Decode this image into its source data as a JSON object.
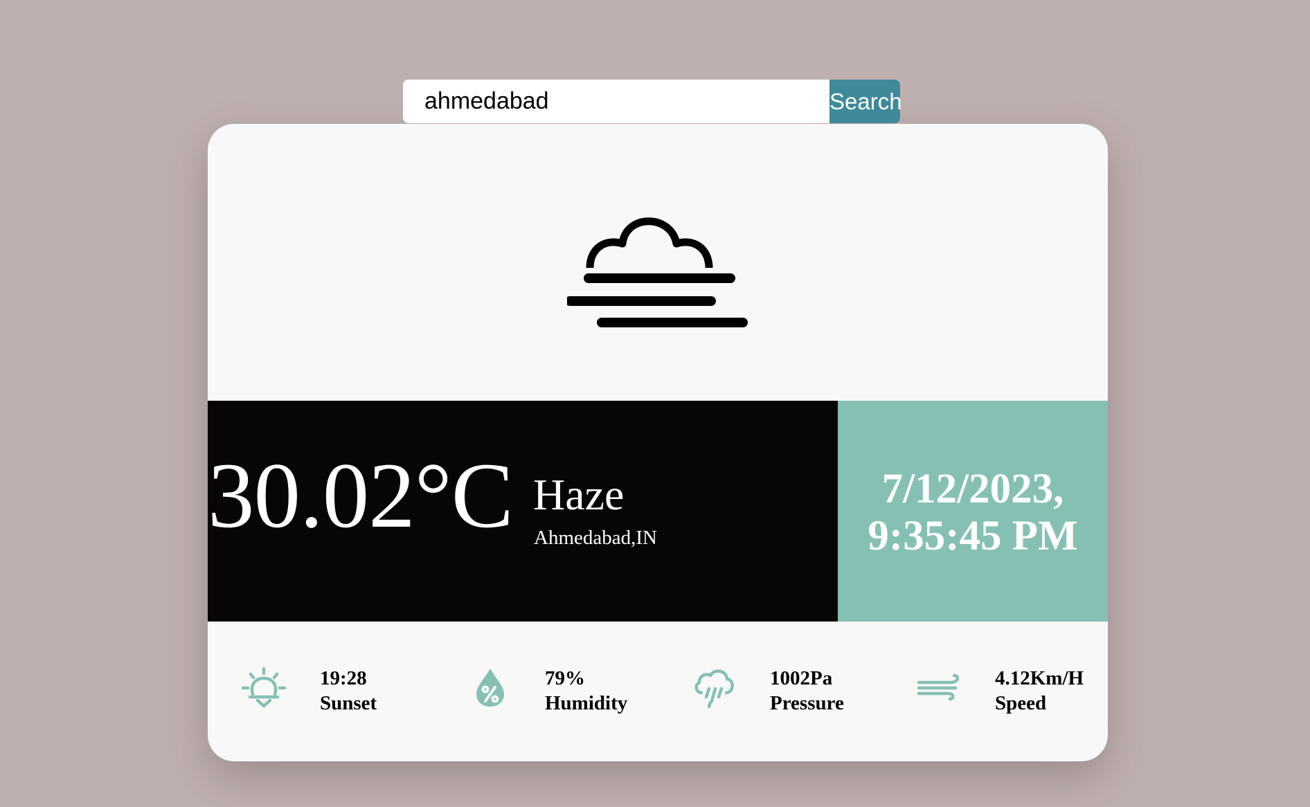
{
  "search": {
    "value": "ahmedabad",
    "button_label": "Search"
  },
  "weather": {
    "icon": "haze-icon",
    "temperature": "30.02°C",
    "condition": "Haze",
    "location": "Ahmedabad,IN"
  },
  "datetime": {
    "date": "7/12/2023,",
    "time": "9:35:45 PM"
  },
  "stats": [
    {
      "value": "19:28",
      "label": "Sunset",
      "icon": "sunset-icon"
    },
    {
      "value": "79%",
      "label": "Humidity",
      "icon": "humidity-drop-icon"
    },
    {
      "value": "1002Pa",
      "label": "Pressure",
      "icon": "rain-cloud-icon"
    },
    {
      "value": "4.12Km/H",
      "label": "Speed",
      "icon": "wind-icon"
    }
  ],
  "colors": {
    "background": "#bfb0b0",
    "card": "#f8f8f8",
    "dark_panel": "#070604",
    "accent": "#86c0b5",
    "search_button": "#3e8a9a"
  }
}
